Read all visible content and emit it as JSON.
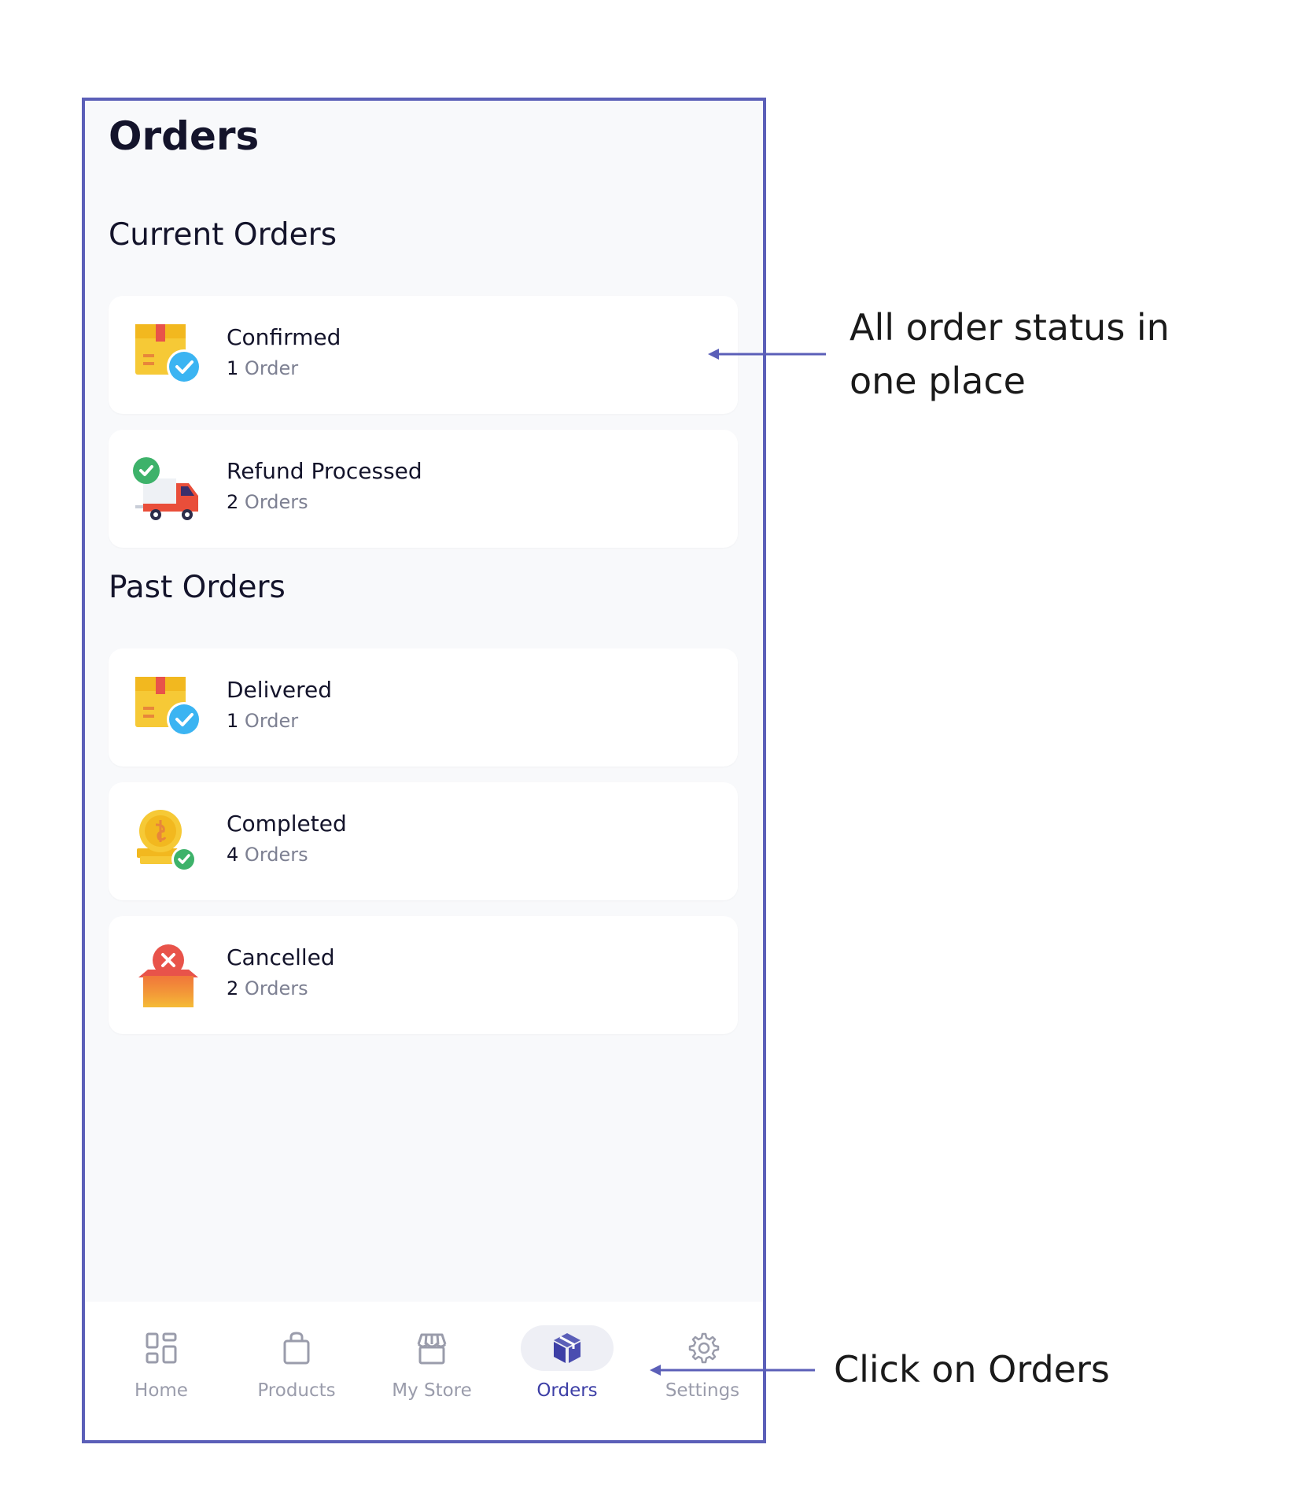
{
  "page_title": "Orders",
  "sections": {
    "current": {
      "title": "Current Orders",
      "cards": [
        {
          "status": "Confirmed",
          "count": "1",
          "unit": "Order",
          "icon": "confirmed-box-icon"
        },
        {
          "status": "Refund Processed",
          "count": "2",
          "unit": "Orders",
          "icon": "refund-truck-icon"
        }
      ]
    },
    "past": {
      "title": "Past Orders",
      "cards": [
        {
          "status": "Delivered",
          "count": "1",
          "unit": "Order",
          "icon": "delivered-box-icon"
        },
        {
          "status": "Completed",
          "count": "4",
          "unit": "Orders",
          "icon": "completed-coin-icon"
        },
        {
          "status": "Cancelled",
          "count": "2",
          "unit": "Orders",
          "icon": "cancelled-box-icon"
        }
      ]
    }
  },
  "nav": {
    "items": [
      {
        "label": "Home",
        "icon": "grid-icon"
      },
      {
        "label": "Products",
        "icon": "bag-icon"
      },
      {
        "label": "My Store",
        "icon": "store-icon"
      },
      {
        "label": "Orders",
        "icon": "cube-icon",
        "active": true
      },
      {
        "label": "Settings",
        "icon": "gear-icon"
      }
    ]
  },
  "annotations": {
    "status_line1": "All order status in",
    "status_line2": "one place",
    "click_orders": "Click on Orders"
  },
  "colors": {
    "frame": "#5b5fb8",
    "accent": "#3d3fa6",
    "card_bg": "#ffffff",
    "screen_bg": "#f8f9fb",
    "muted_text": "#7d8092"
  }
}
